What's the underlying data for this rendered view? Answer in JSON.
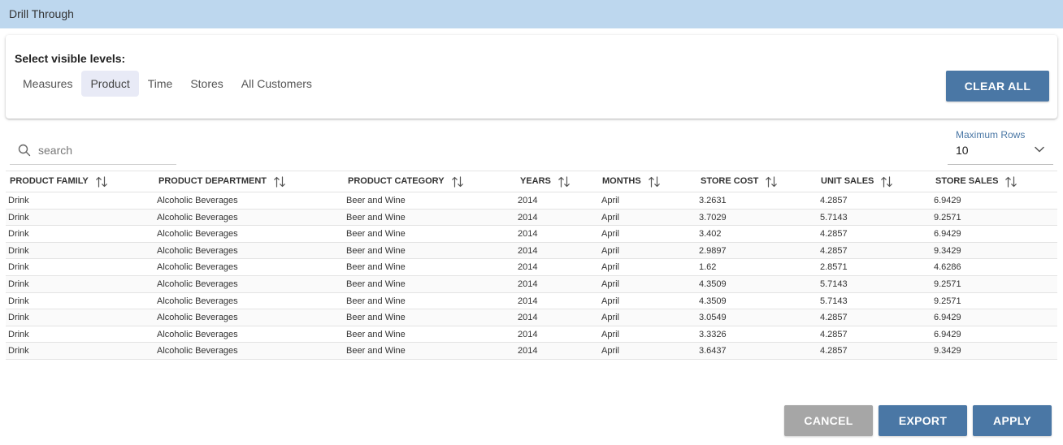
{
  "window": {
    "title": "Drill Through"
  },
  "levels": {
    "heading": "Select visible levels:",
    "chips": [
      {
        "label": "Measures",
        "active": false
      },
      {
        "label": "Product",
        "active": true
      },
      {
        "label": "Time",
        "active": false
      },
      {
        "label": "Stores",
        "active": false
      },
      {
        "label": "All Customers",
        "active": false
      }
    ],
    "clear_all_label": "CLEAR ALL"
  },
  "search": {
    "placeholder": "search",
    "value": ""
  },
  "max_rows": {
    "label": "Maximum Rows",
    "value": "10"
  },
  "table": {
    "columns": [
      "PRODUCT FAMILY",
      "PRODUCT DEPARTMENT",
      "PRODUCT CATEGORY",
      "YEARS",
      "MONTHS",
      "STORE COST",
      "UNIT SALES",
      "STORE SALES"
    ],
    "rows": [
      [
        "Drink",
        "Alcoholic Beverages",
        "Beer and Wine",
        "2014",
        "April",
        "3.2631",
        "4.2857",
        "6.9429"
      ],
      [
        "Drink",
        "Alcoholic Beverages",
        "Beer and Wine",
        "2014",
        "April",
        "3.7029",
        "5.7143",
        "9.2571"
      ],
      [
        "Drink",
        "Alcoholic Beverages",
        "Beer and Wine",
        "2014",
        "April",
        "3.402",
        "4.2857",
        "6.9429"
      ],
      [
        "Drink",
        "Alcoholic Beverages",
        "Beer and Wine",
        "2014",
        "April",
        "2.9897",
        "4.2857",
        "9.3429"
      ],
      [
        "Drink",
        "Alcoholic Beverages",
        "Beer and Wine",
        "2014",
        "April",
        "1.62",
        "2.8571",
        "4.6286"
      ],
      [
        "Drink",
        "Alcoholic Beverages",
        "Beer and Wine",
        "2014",
        "April",
        "4.3509",
        "5.7143",
        "9.2571"
      ],
      [
        "Drink",
        "Alcoholic Beverages",
        "Beer and Wine",
        "2014",
        "April",
        "4.3509",
        "5.7143",
        "9.2571"
      ],
      [
        "Drink",
        "Alcoholic Beverages",
        "Beer and Wine",
        "2014",
        "April",
        "3.0549",
        "4.2857",
        "6.9429"
      ],
      [
        "Drink",
        "Alcoholic Beverages",
        "Beer and Wine",
        "2014",
        "April",
        "3.3326",
        "4.2857",
        "6.9429"
      ],
      [
        "Drink",
        "Alcoholic Beverages",
        "Beer and Wine",
        "2014",
        "April",
        "3.6437",
        "4.2857",
        "9.3429"
      ]
    ]
  },
  "footer": {
    "cancel_label": "CANCEL",
    "export_label": "EXPORT",
    "apply_label": "APPLY"
  },
  "colors": {
    "titlebar": "#bdd7ee",
    "primary": "#4a77a5",
    "cancel": "#a6a6a6",
    "chip_active": "#e8eaf6"
  },
  "icons": {
    "search": "search-icon",
    "sort": "sort-arrows-icon",
    "dropdown": "chevron-down-icon"
  }
}
